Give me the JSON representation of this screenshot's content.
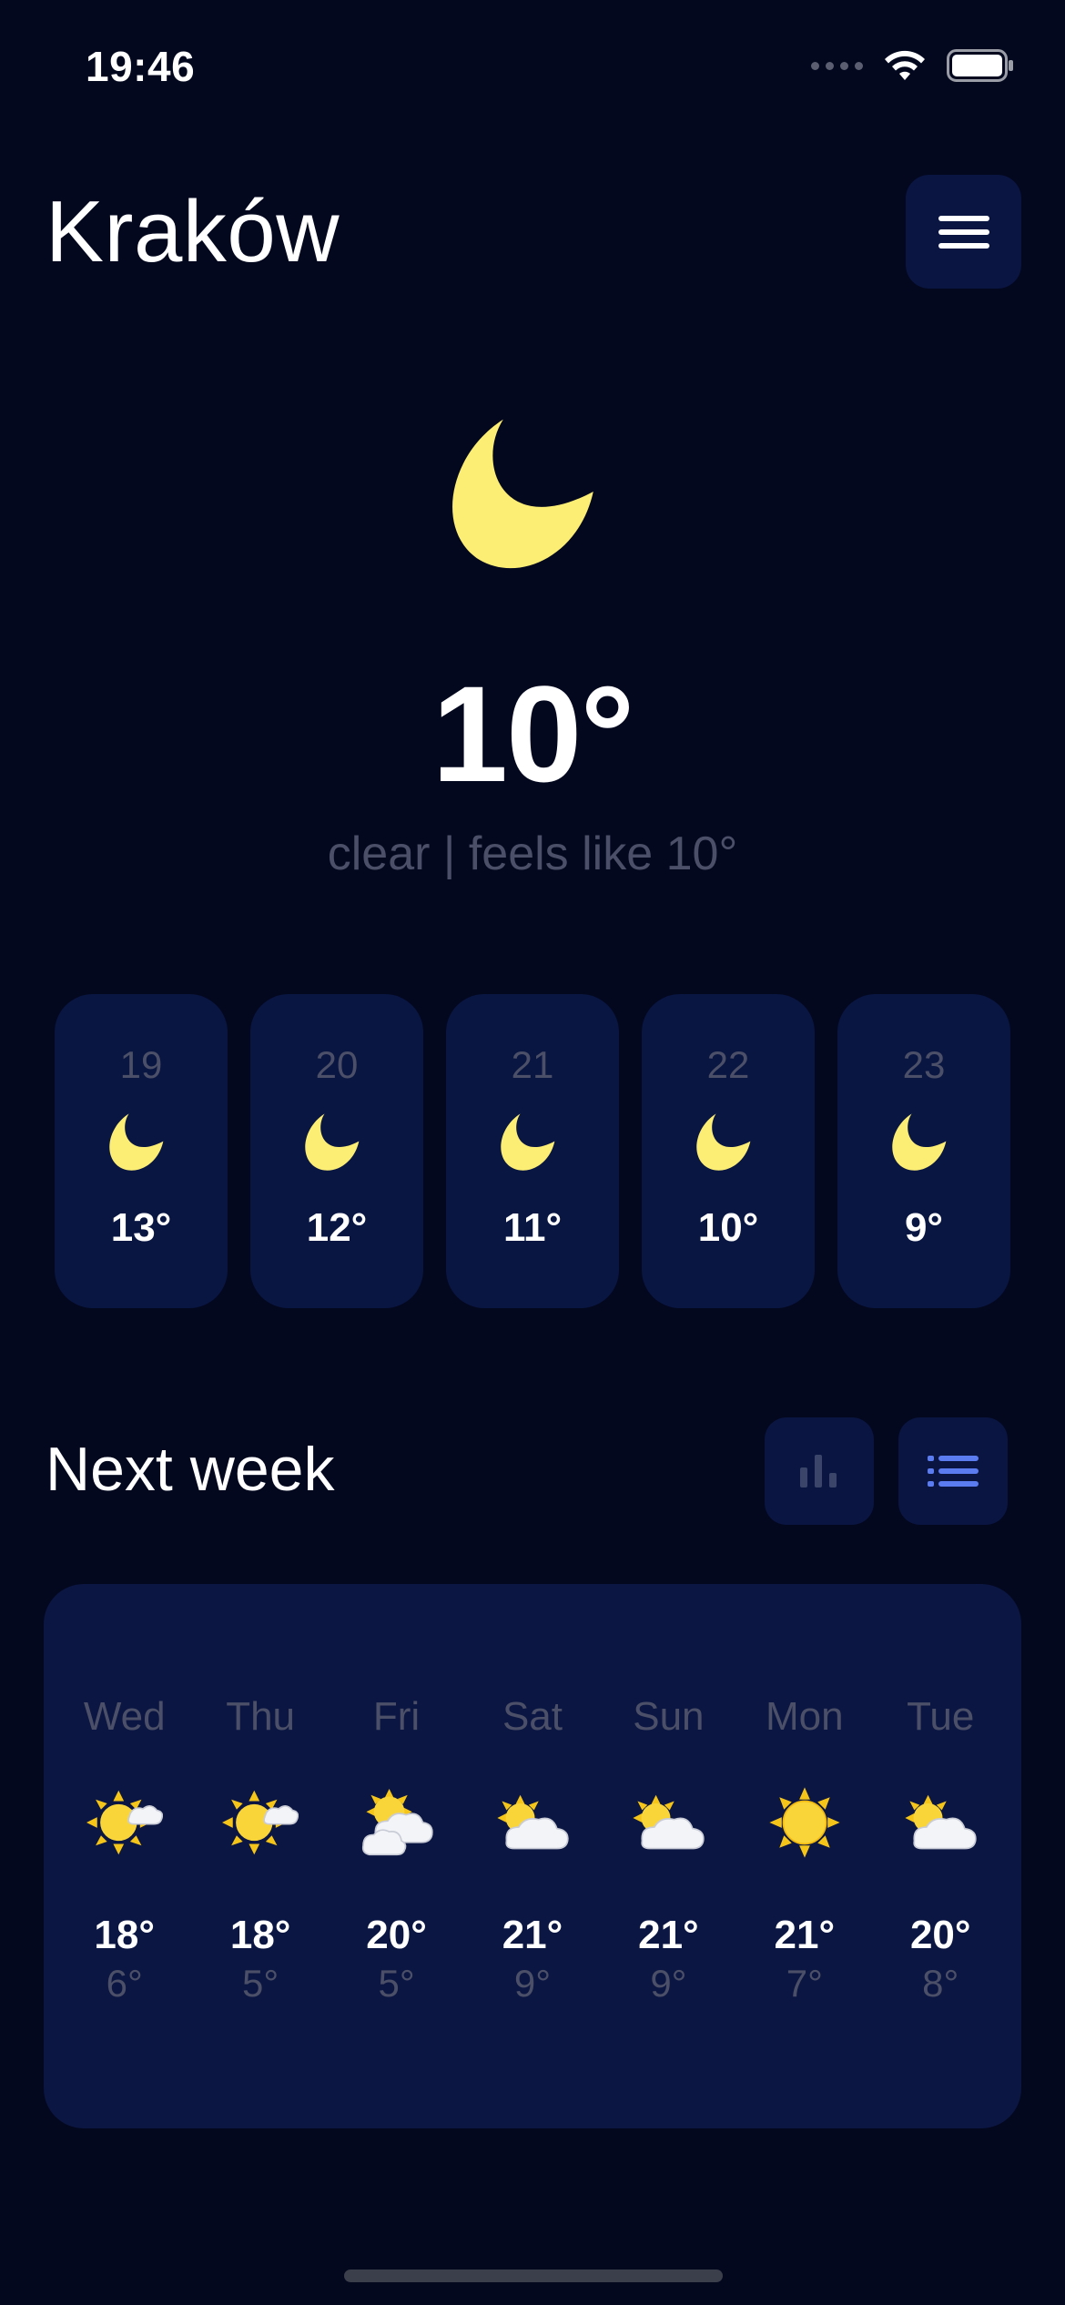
{
  "status_bar": {
    "time": "19:46"
  },
  "header": {
    "city": "Kraków"
  },
  "current": {
    "icon": "moon-icon",
    "temperature": "10°",
    "description": "clear | feels like 10°"
  },
  "hourly": [
    {
      "hour": "19",
      "icon": "moon-icon",
      "temp": "13°"
    },
    {
      "hour": "20",
      "icon": "moon-icon",
      "temp": "12°"
    },
    {
      "hour": "21",
      "icon": "moon-icon",
      "temp": "11°"
    },
    {
      "hour": "22",
      "icon": "moon-icon",
      "temp": "10°"
    },
    {
      "hour": "23",
      "icon": "moon-icon",
      "temp": "9°"
    }
  ],
  "next_week": {
    "title": "Next week",
    "days": [
      {
        "day": "Wed",
        "icon": "sun-small-cloud-icon",
        "high": "18°",
        "low": "6°"
      },
      {
        "day": "Thu",
        "icon": "sun-small-cloud-icon",
        "high": "18°",
        "low": "5°"
      },
      {
        "day": "Fri",
        "icon": "sun-behind-clouds-icon",
        "high": "20°",
        "low": "5°"
      },
      {
        "day": "Sat",
        "icon": "sun-behind-cloud-icon",
        "high": "21°",
        "low": "9°"
      },
      {
        "day": "Sun",
        "icon": "sun-behind-cloud-icon",
        "high": "21°",
        "low": "9°"
      },
      {
        "day": "Mon",
        "icon": "sun-icon",
        "high": "21°",
        "low": "7°"
      },
      {
        "day": "Tue",
        "icon": "sun-behind-cloud-icon",
        "high": "20°",
        "low": "8°"
      }
    ]
  },
  "colors": {
    "background": "#03081f",
    "card": "#0a1642",
    "muted_text": "#4b4f67",
    "moon": "#fced74",
    "accent": "#5b7cf0"
  }
}
